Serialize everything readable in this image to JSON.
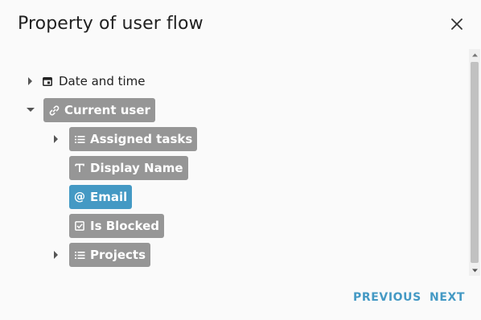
{
  "dialog": {
    "title": "Property of user flow",
    "close_icon": "close-icon"
  },
  "tree": {
    "items": [
      {
        "label": "Date and time",
        "icon": "calendar-icon",
        "expanded": false,
        "selected": false
      },
      {
        "label": "Current user",
        "icon": "link-icon",
        "expanded": true,
        "selected": false,
        "children": [
          {
            "label": "Assigned tasks",
            "icon": "list-icon",
            "expandable": true
          },
          {
            "label": "Display Name",
            "icon": "text-type-icon",
            "expandable": false
          },
          {
            "label": "Email",
            "icon": "at-icon",
            "expandable": false,
            "selected": true
          },
          {
            "label": "Is Blocked",
            "icon": "checkbox-icon",
            "expandable": false
          },
          {
            "label": "Projects",
            "icon": "list-icon",
            "expandable": true
          }
        ]
      }
    ]
  },
  "actions": {
    "previous_label": "PREVIOUS",
    "next_label": "NEXT"
  },
  "colors": {
    "chip": "#969696",
    "chip_selected": "#4499c4",
    "accent": "#4499c4",
    "background": "#fafafa"
  }
}
